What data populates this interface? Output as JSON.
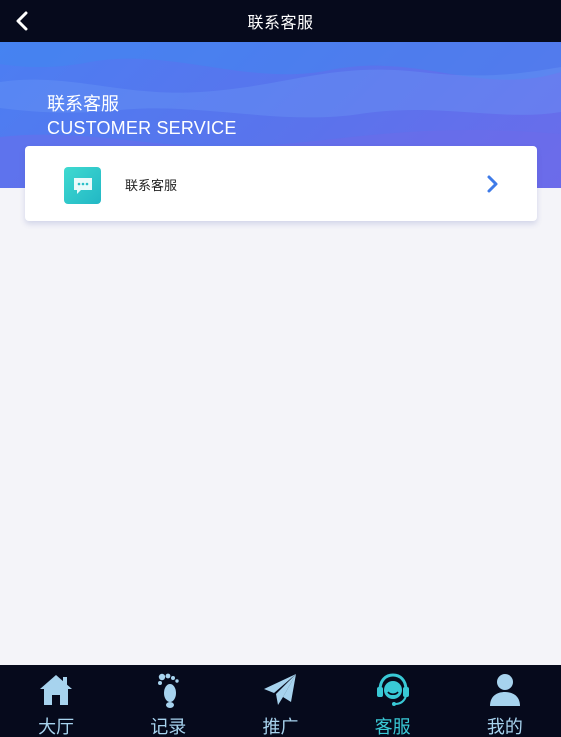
{
  "header": {
    "title": "联系客服"
  },
  "banner": {
    "title": "联系客服",
    "subtitle": "CUSTOMER SERVICE"
  },
  "contact_card": {
    "label": "联系客服"
  },
  "tabbar": {
    "items": [
      {
        "label": "大厅",
        "icon": "home-icon"
      },
      {
        "label": "记录",
        "icon": "footprints-icon"
      },
      {
        "label": "推广",
        "icon": "paper-plane-icon"
      },
      {
        "label": "客服",
        "icon": "headset-agent-icon",
        "active": true
      },
      {
        "label": "我的",
        "icon": "user-icon"
      }
    ]
  },
  "colors": {
    "top_bar": "#060a1c",
    "banner_start": "#4c7ef2",
    "banner_end": "#6a6ceb",
    "chat_tile": "#2ec8c9",
    "chevron": "#3f7be8",
    "tab_inactive": "#a7d3ee",
    "tab_active": "#39c9d6",
    "page_bg": "#f4f4f9"
  }
}
